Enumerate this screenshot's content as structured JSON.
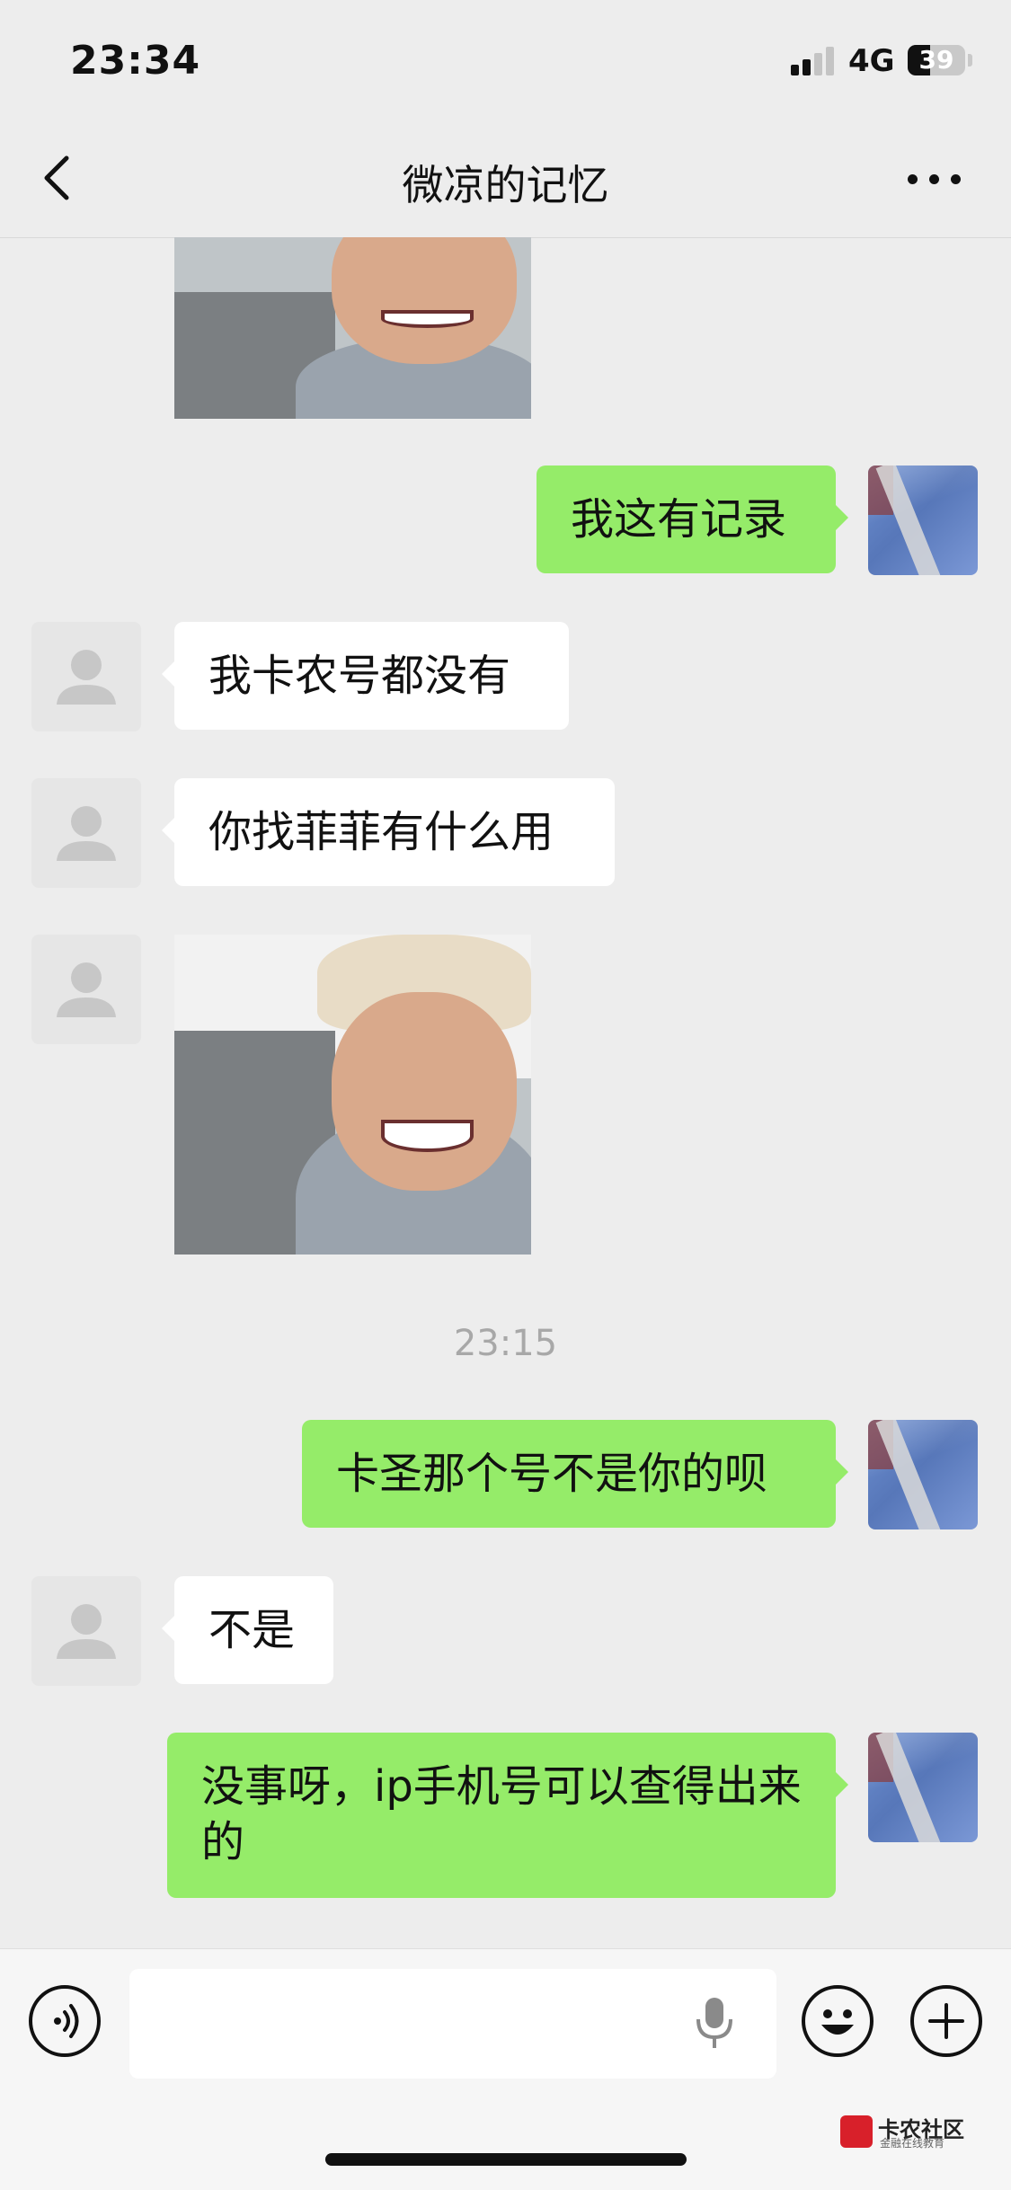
{
  "status_bar": {
    "time": "23:34",
    "network": "4G",
    "battery": "39",
    "battery_level_percent": 39
  },
  "header": {
    "title": "微凉的记忆"
  },
  "timestamp": "23:15",
  "messages": [
    {
      "type": "sticker",
      "from": "other"
    },
    {
      "type": "text",
      "from": "self",
      "text": "我这有记录"
    },
    {
      "type": "text",
      "from": "other",
      "text": "我卡农号都没有"
    },
    {
      "type": "text",
      "from": "other",
      "text": "你找菲菲有什么用"
    },
    {
      "type": "sticker",
      "from": "other"
    },
    {
      "type": "text",
      "from": "self",
      "text": "卡圣那个号不是你的呗"
    },
    {
      "type": "text",
      "from": "other",
      "text": "不是"
    },
    {
      "type": "text",
      "from": "self",
      "text": "没事呀，ip手机号可以查得出来的"
    }
  ],
  "input_bar": {
    "placeholder": ""
  },
  "watermark": {
    "title": "卡农社区",
    "subtitle": "金融在线教育"
  },
  "colors": {
    "self_bubble": "#95ec69",
    "other_bubble": "#ffffff",
    "background": "#ededed"
  }
}
